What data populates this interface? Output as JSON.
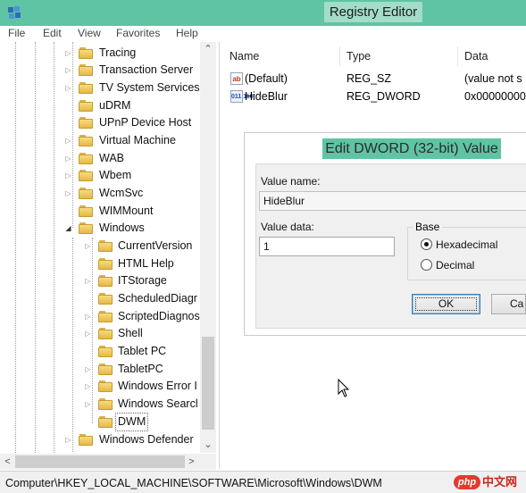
{
  "window": {
    "title": "Registry Editor",
    "icon": "registry-editor-icon",
    "accent_color": "#5fc4a4"
  },
  "menu": [
    "File",
    "Edit",
    "View",
    "Favorites",
    "Help"
  ],
  "tree": {
    "nodes": [
      {
        "label": "Tracing",
        "expandable": true
      },
      {
        "label": "Transaction Server",
        "expandable": true
      },
      {
        "label": "TV System Services",
        "expandable": true
      },
      {
        "label": "uDRM",
        "expandable": false
      },
      {
        "label": "UPnP Device Host",
        "expandable": false
      },
      {
        "label": "Virtual Machine",
        "expandable": true
      },
      {
        "label": "WAB",
        "expandable": true
      },
      {
        "label": "Wbem",
        "expandable": true
      },
      {
        "label": "WcmSvc",
        "expandable": true
      },
      {
        "label": "WIMMount",
        "expandable": false
      },
      {
        "label": "Windows",
        "expandable": true,
        "expanded": true
      },
      {
        "label": "CurrentVersion",
        "expandable": true
      },
      {
        "label": "HTML Help",
        "expandable": false
      },
      {
        "label": "ITStorage",
        "expandable": true
      },
      {
        "label": "ScheduledDiagr",
        "expandable": false
      },
      {
        "label": "ScriptedDiagnos",
        "expandable": true
      },
      {
        "label": "Shell",
        "expandable": true
      },
      {
        "label": "Tablet PC",
        "expandable": false
      },
      {
        "label": "TabletPC",
        "expandable": true
      },
      {
        "label": "Windows Error I",
        "expandable": true
      },
      {
        "label": "Windows Searcl",
        "expandable": true
      },
      {
        "label": "DWM",
        "expandable": false,
        "selected": true
      },
      {
        "label": "Windows Defender",
        "expandable": true
      }
    ]
  },
  "list": {
    "columns": [
      "Name",
      "Type",
      "Data"
    ],
    "rows": [
      {
        "icon": "string-value-icon",
        "icon_text": "ab",
        "name": "(Default)",
        "type": "REG_SZ",
        "data": "(value not s"
      },
      {
        "icon": "binary-value-icon",
        "icon_text": "011 110",
        "name": "HideBlur",
        "type": "REG_DWORD",
        "data": "0x00000000"
      }
    ]
  },
  "dialog": {
    "title": "Edit DWORD (32-bit) Value",
    "value_name_label": "Value name:",
    "value_name": "HideBlur",
    "value_data_label": "Value data:",
    "value_data": "1",
    "base_label": "Base",
    "base_options": [
      "Hexadecimal",
      "Decimal"
    ],
    "base_selected": "Hexadecimal",
    "ok_label": "OK",
    "cancel_label": "Ca"
  },
  "statusbar": {
    "path": "Computer\\HKEY_LOCAL_MACHINE\\SOFTWARE\\Microsoft\\Windows\\DWM"
  },
  "watermark": {
    "badge": "php",
    "text": "中文网"
  }
}
